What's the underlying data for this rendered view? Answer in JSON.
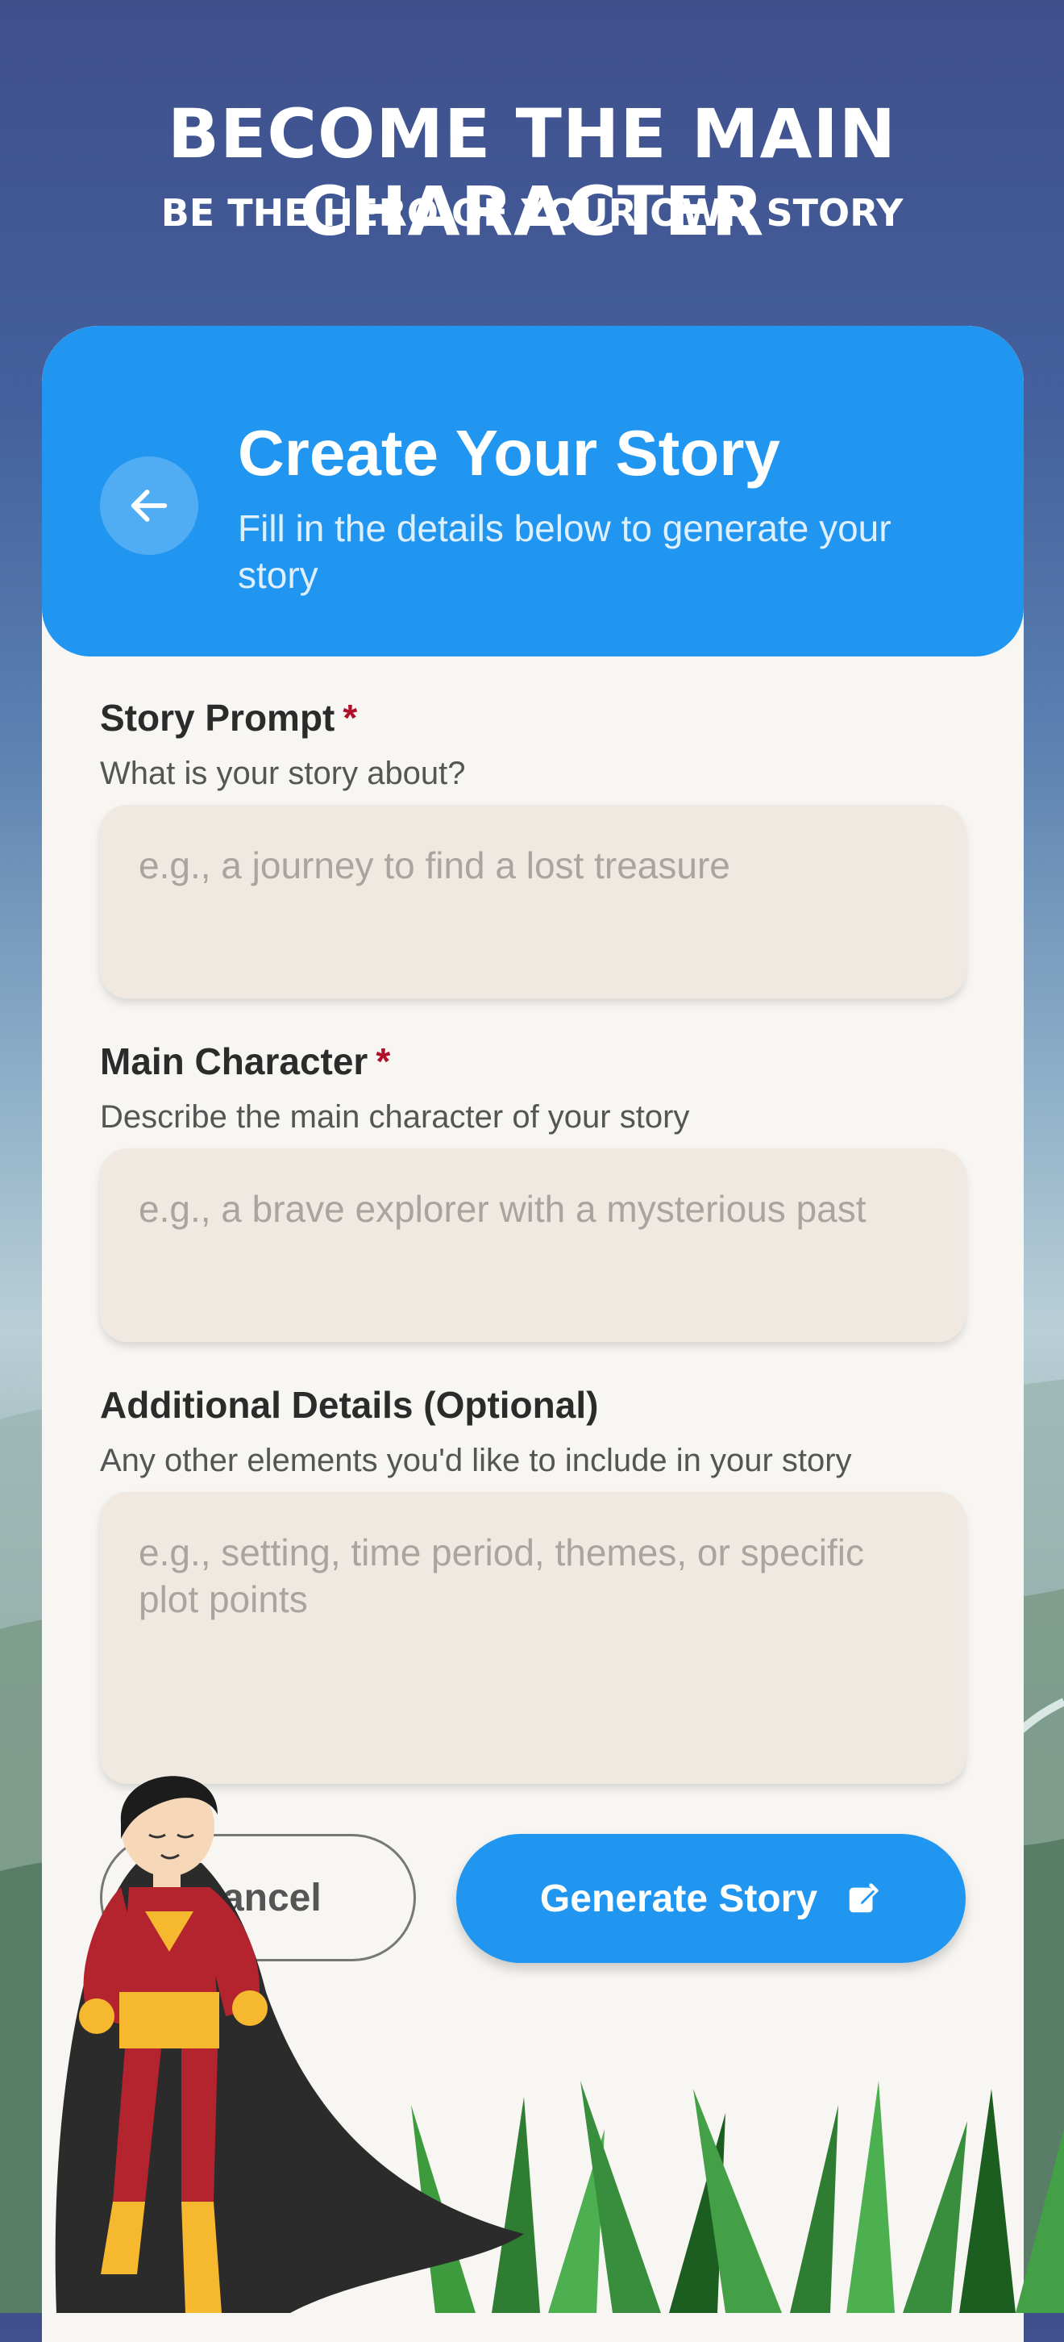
{
  "banner": {
    "title": "BECOME THE MAIN CHARACTER",
    "subtitle": "BE THE HERO OF YOUR OWN STORY"
  },
  "header": {
    "title": "Create Your Story",
    "subtitle": "Fill in the details below to generate your story",
    "back_icon": "arrow-left-icon"
  },
  "form": {
    "prompt": {
      "label": "Story Prompt",
      "required_mark": "*",
      "help": "What is your story about?",
      "placeholder": "e.g., a journey to find a lost treasure",
      "value": ""
    },
    "character": {
      "label": "Main Character",
      "required_mark": "*",
      "help": "Describe the main character of your story",
      "placeholder": "e.g., a brave explorer with a mysterious past",
      "value": ""
    },
    "details": {
      "label": "Additional Details (Optional)",
      "help": "Any other elements you'd like to include in your story",
      "placeholder": "e.g., setting, time period, themes, or specific plot points",
      "value": ""
    }
  },
  "actions": {
    "cancel_label": "Cancel",
    "generate_label": "Generate Story",
    "generate_icon": "edit-icon"
  },
  "colors": {
    "accent": "#2196F0",
    "card_bg": "#F8F6F2",
    "field_bg": "#F0E9E2",
    "required": "#B0102A"
  }
}
